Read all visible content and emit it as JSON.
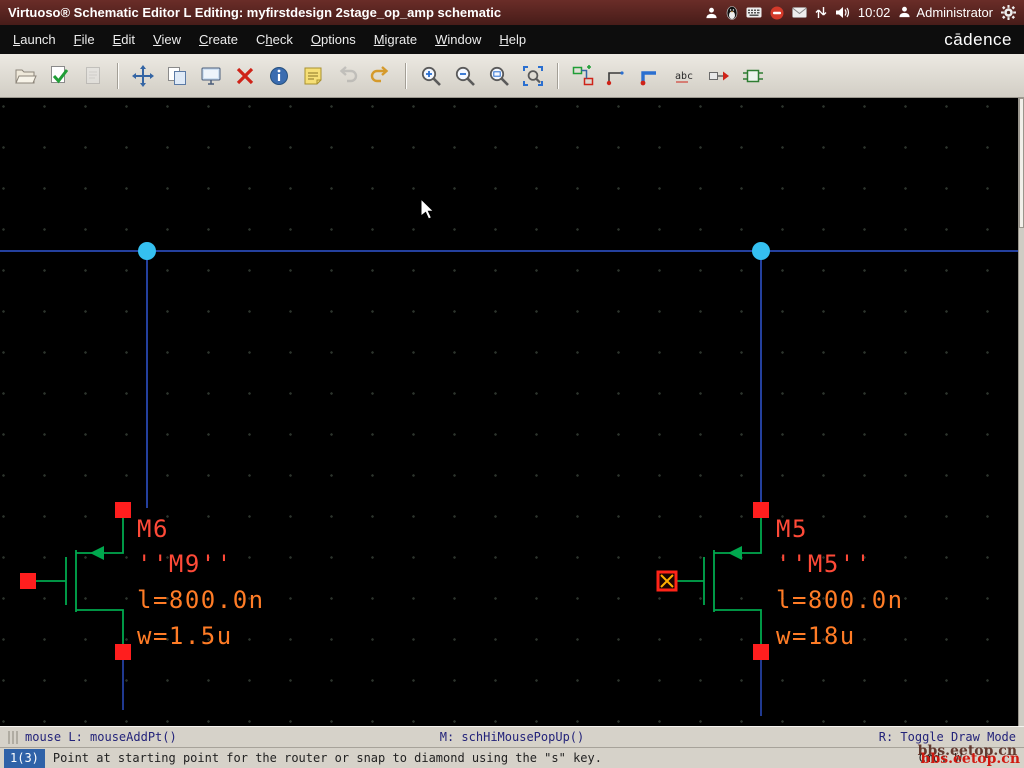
{
  "titlebar": {
    "title": "Virtuoso® Schematic Editor L Editing: myfirstdesign 2stage_op_amp schematic",
    "clock": "10:02",
    "user": "Administrator",
    "tray": [
      "user-icon",
      "penguin-icon",
      "keyboard-icon",
      "dnd-icon",
      "mail-icon",
      "updown-icon",
      "volume-icon"
    ]
  },
  "menubar": {
    "items": [
      {
        "label": "Launch",
        "underline": 0
      },
      {
        "label": "File",
        "underline": 0
      },
      {
        "label": "Edit",
        "underline": 0
      },
      {
        "label": "View",
        "underline": 0
      },
      {
        "label": "Create",
        "underline": 0
      },
      {
        "label": "Check",
        "underline": 1
      },
      {
        "label": "Options",
        "underline": 0
      },
      {
        "label": "Migrate",
        "underline": 0
      },
      {
        "label": "Window",
        "underline": 0
      },
      {
        "label": "Help",
        "underline": 0
      }
    ],
    "brand": "cādence"
  },
  "toolbar": {
    "buttons": [
      {
        "name": "open"
      },
      {
        "name": "check-and-save"
      },
      {
        "name": "save",
        "disabled": true
      },
      {
        "sep": true
      },
      {
        "name": "move"
      },
      {
        "name": "copy"
      },
      {
        "name": "display"
      },
      {
        "name": "delete"
      },
      {
        "name": "properties"
      },
      {
        "name": "note"
      },
      {
        "name": "undo",
        "disabled": true
      },
      {
        "name": "redo"
      },
      {
        "sep": true
      },
      {
        "name": "zoom-in"
      },
      {
        "name": "zoom-out"
      },
      {
        "name": "zoom-selected"
      },
      {
        "name": "zoom-fit"
      },
      {
        "sep": true
      },
      {
        "name": "instance"
      },
      {
        "name": "wire-narrow"
      },
      {
        "name": "wire-wide"
      },
      {
        "name": "label"
      },
      {
        "name": "pin"
      },
      {
        "name": "block"
      }
    ]
  },
  "schematic": {
    "instances": [
      {
        "name": "M6",
        "model": "''M9''",
        "length": "l=800.0n",
        "width": "w=1.5u"
      },
      {
        "name": "M5",
        "model": "''M5''",
        "length": "l=800.0n",
        "width": "w=18u"
      }
    ],
    "colors": {
      "wire": "#3156d2",
      "device": "#00a84e",
      "pin": "#ff1e1e",
      "solder_dot": "#35c0f0",
      "name_label": "#ff4a38",
      "param_label": "#ff7c26"
    }
  },
  "statusbar": {
    "left": "mouse L: mouseAddPt()",
    "middle": "M: schHiMousePopUp()",
    "right": "R: Toggle Draw Mode"
  },
  "promptbar": {
    "counter": "1(3)",
    "message": "Point at starting point for the router or snap to diamond using the \"s\" key.",
    "cmd": "Cmd: W",
    "watermark": "bbs.eetop.cn"
  }
}
